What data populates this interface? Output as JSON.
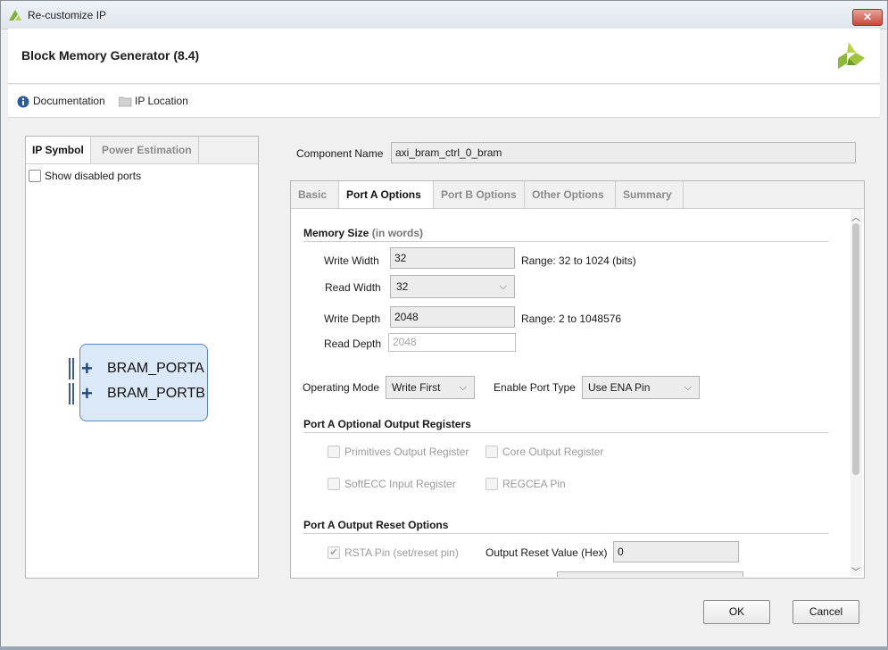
{
  "window": {
    "title": "Re-customize IP",
    "close_symbol": "✕"
  },
  "header": {
    "ip_name": "Block Memory Generator (8.4)"
  },
  "links": {
    "documentation": "Documentation",
    "ip_location": "IP Location"
  },
  "left_panel": {
    "tabs": [
      "IP Symbol",
      "Power Estimation"
    ],
    "show_disabled_ports": {
      "label": "Show disabled ports",
      "checked": false
    },
    "symbol": {
      "ports": [
        "BRAM_PORTA",
        "BRAM_PORTB"
      ],
      "plus": "+"
    }
  },
  "component_name": {
    "label": "Component Name",
    "value": "axi_bram_ctrl_0_bram"
  },
  "right_tabs": [
    "Basic",
    "Port A Options",
    "Port B Options",
    "Other Options",
    "Summary"
  ],
  "memory_size": {
    "title": "Memory Size",
    "subtitle": "(in words)",
    "write_width": {
      "label": "Write Width",
      "value": "32",
      "range": "Range: 32 to 1024 (bits)"
    },
    "read_width": {
      "label": "Read Width",
      "value": "32"
    },
    "write_depth": {
      "label": "Write Depth",
      "value": "2048",
      "range": "Range: 2 to 1048576"
    },
    "read_depth": {
      "label": "Read Depth",
      "value": "2048"
    }
  },
  "operating_mode": {
    "label": "Operating Mode",
    "value": "Write First"
  },
  "enable_port_type": {
    "label": "Enable Port Type",
    "value": "Use ENA Pin"
  },
  "output_registers": {
    "title": "Port A Optional Output Registers",
    "primitives": "Primitives Output Register",
    "core": "Core Output Register",
    "softecc": "SoftECC Input Register",
    "regcea": "REGCEA Pin"
  },
  "reset_options": {
    "title": "Port A Output Reset Options",
    "rsta": {
      "label": "RSTA Pin (set/reset pin)",
      "checked": true
    },
    "output_reset_value": {
      "label": "Output Reset Value (Hex)",
      "value": "0"
    }
  },
  "buttons": {
    "ok": "OK",
    "cancel": "Cancel"
  },
  "icons": {
    "chevron": "⌵",
    "scroll_up": "︿",
    "scroll_down": "﹀",
    "check": "✔"
  },
  "colors": {
    "xilinx_green": "#8bb83a",
    "accent_blue": "#2f5b9c"
  }
}
